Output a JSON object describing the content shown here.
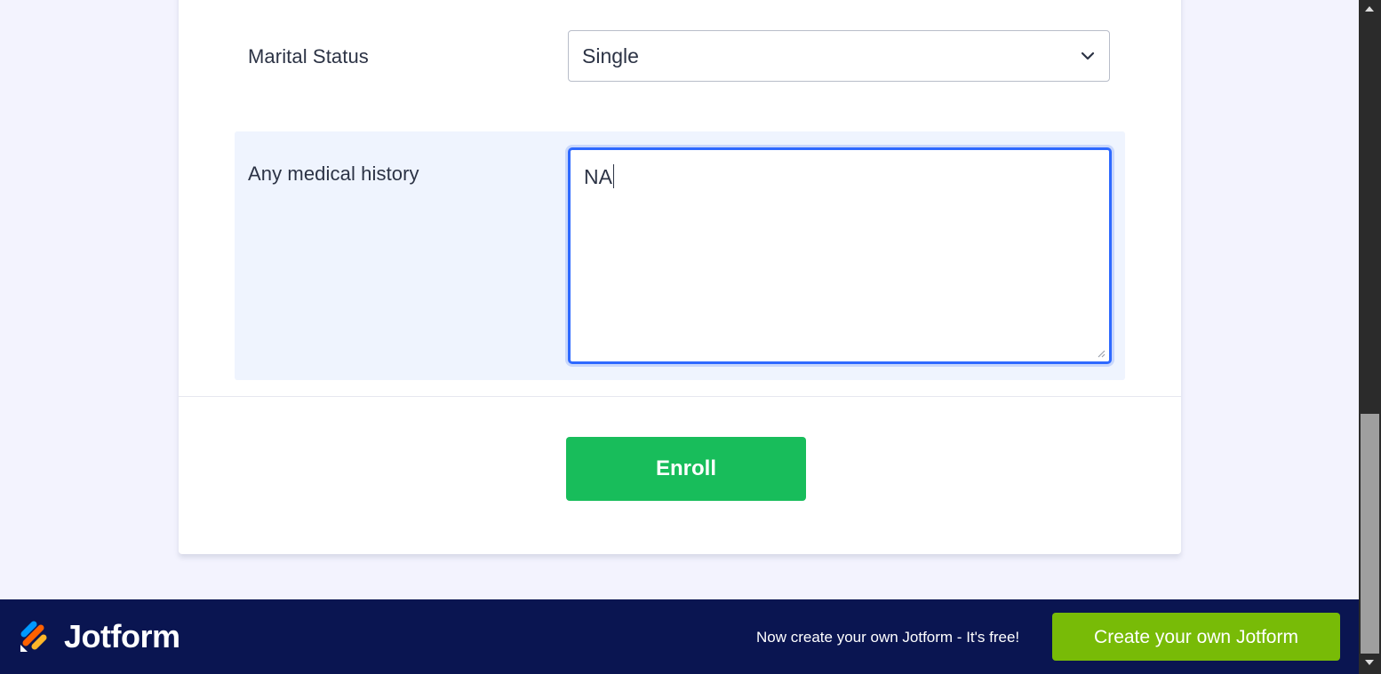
{
  "form": {
    "marital_status": {
      "label": "Marital Status",
      "selected": "Single"
    },
    "medical_history": {
      "label": "Any medical history",
      "value": "NA"
    },
    "submit_label": "Enroll"
  },
  "footer": {
    "brand": "Jotform",
    "tagline": "Now create your own Jotform - It's free!",
    "cta_label": "Create your own Jotform"
  },
  "colors": {
    "submit_green": "#18bd5b",
    "cta_green": "#78bb07",
    "footer_navy": "#0a1551",
    "focus_blue": "#2e69ff"
  },
  "icons": {
    "select_arrow": "chevron-down-icon",
    "resize": "resize-grip-icon",
    "logo": "jotform-logo-icon"
  }
}
